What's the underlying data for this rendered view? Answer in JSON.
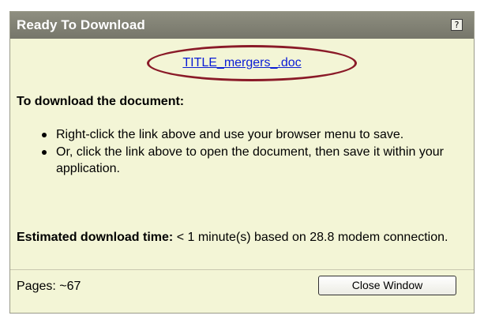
{
  "dialog": {
    "title": "Ready To Download",
    "help_label": "?",
    "file_link": "TITLE_mergers_.doc",
    "heading": "To download the document:",
    "instructions": [
      "Right-click the link above and use your browser menu to save.",
      "Or, click the link above to open the document, then save it within your application."
    ],
    "estimate_label": "Estimated download time:",
    "estimate_value": "< 1 minute(s) based on 28.8 modem connection.",
    "pages": "Pages: ~67",
    "close_button": "Close Window"
  },
  "colors": {
    "titlebar": "#76766a",
    "panel_bg": "#f3f5d6",
    "link": "#0a1cd6",
    "highlight": "#8a1a28"
  }
}
